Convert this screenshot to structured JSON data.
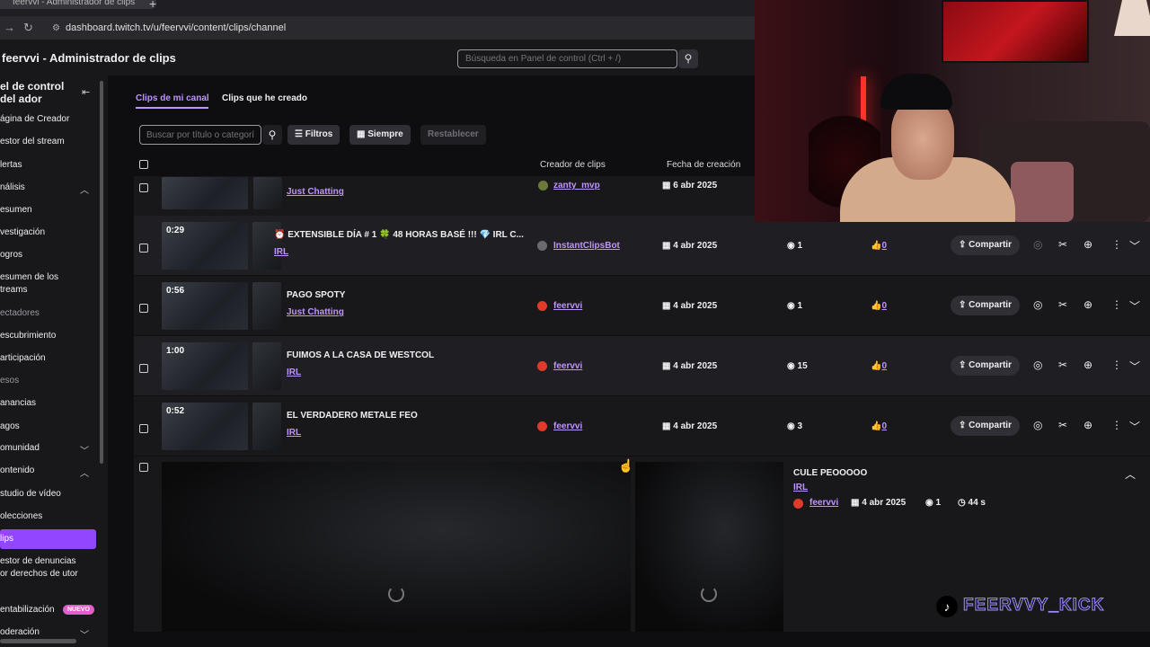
{
  "browser": {
    "tab_title": "feervvi - Administrador de clips",
    "url": "dashboard.twitch.tv/u/feervvi/content/clips/channel"
  },
  "header": {
    "title": "feervvi - Administrador de clips",
    "search_placeholder": "Búsqueda en Panel de control (Ctrl + /)"
  },
  "sidebar": {
    "heading": "el de control del ador",
    "items": [
      "ágina de Creador",
      "estor del stream",
      "lertas",
      "nálisis",
      "esumen",
      "vestigación",
      "ogros",
      "esumen de los treams",
      "ectadores",
      "escubrimiento",
      "articipación",
      "esos",
      "anancias",
      "agos",
      "omunidad",
      "ontenido",
      "studio de vídeo",
      "olecciones",
      "lips",
      "estor de denuncias or derechos de utor",
      "entabilización",
      "oderación"
    ],
    "new_badge": "NUEVO"
  },
  "main": {
    "tabs": [
      "Clips de mi canal",
      "Clips que he creado"
    ],
    "filter_placeholder": "Buscar por título o categoría",
    "filters_label": "Filtros",
    "period_label": "Siempre",
    "reset_label": "Restablecer",
    "columns": {
      "creator": "Creador de clips",
      "date": "Fecha de creación"
    },
    "share_label": "Compartir",
    "rows": [
      {
        "duration": "",
        "title": "",
        "category": "Just Chatting",
        "creator": "zanty_mvp",
        "date": "6 abr 2025",
        "views": "",
        "likes": ""
      },
      {
        "duration": "0:29",
        "title": "⏰ EXTENSIBLE DÍA # 1 🍀 48 HORAS BASÉ !!! 💎 IRL C...",
        "category": "IRL",
        "creator": "InstantClipsBot",
        "date": "4 abr 2025",
        "views": "1",
        "likes": "0"
      },
      {
        "duration": "0:56",
        "title": "PAGO SPOTY",
        "category": "Just Chatting",
        "creator": "feervvi",
        "date": "4 abr 2025",
        "views": "1",
        "likes": "0"
      },
      {
        "duration": "1:00",
        "title": "FUIMOS A LA CASA DE WESTCOL",
        "category": "IRL",
        "creator": "feervvi",
        "date": "4 abr 2025",
        "views": "15",
        "likes": "0"
      },
      {
        "duration": "0:52",
        "title": "EL VERDADERO METALE FEO",
        "category": "IRL",
        "creator": "feervvi",
        "date": "4 abr 2025",
        "views": "3",
        "likes": "0"
      }
    ],
    "expanded": {
      "title": "CULE PEOOOOO",
      "category": "IRL",
      "creator": "feervvi",
      "date": "4 abr 2025",
      "views": "1",
      "length": "44 s"
    }
  },
  "overlay": {
    "watermark": "FEERVVY_KICK"
  },
  "colors": {
    "accent": "#bf94ff",
    "brand": "#9147ff",
    "bg": "#0e0e10"
  }
}
